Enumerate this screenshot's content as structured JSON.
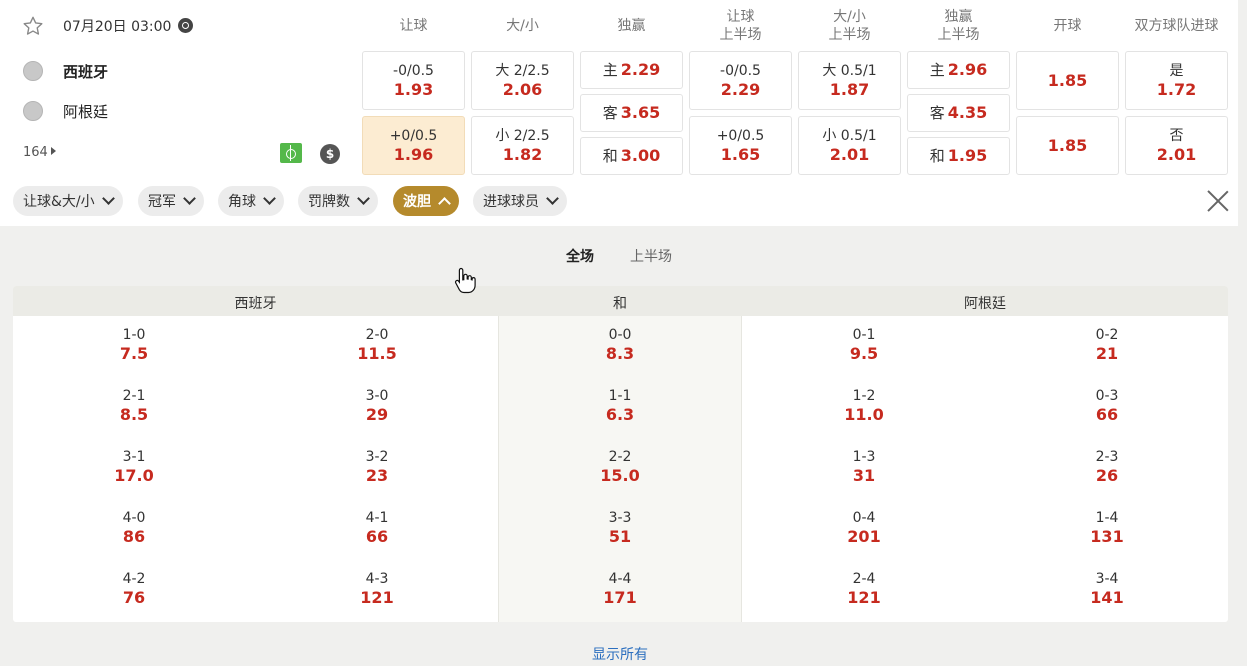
{
  "match": {
    "datetime": "07月20日 03:00",
    "home": "西班牙",
    "away": "阿根廷",
    "market_count": "164",
    "money_symbol": "$"
  },
  "headers": {
    "handicap": "让球",
    "total": "大/小",
    "moneyline": "独赢",
    "handicap_fh_1": "让球",
    "handicap_fh_2": "上半场",
    "total_fh_1": "大/小",
    "total_fh_2": "上半场",
    "moneyline_fh_1": "独赢",
    "moneyline_fh_2": "上半场",
    "kickoff": "开球",
    "btts": "双方球队进球"
  },
  "odds": {
    "handicap_home_line": "-0/0.5",
    "handicap_home": "1.93",
    "handicap_away_line": "+0/0.5",
    "handicap_away": "1.96",
    "total_over_line": "大 2/2.5",
    "total_over": "2.06",
    "total_under_line": "小 2/2.5",
    "total_under": "1.82",
    "ml_home_label": "主",
    "ml_home": "2.29",
    "ml_away_label": "客",
    "ml_away": "3.65",
    "ml_draw_label": "和",
    "ml_draw": "3.00",
    "fh_handicap_home_line": "-0/0.5",
    "fh_handicap_home": "2.29",
    "fh_handicap_away_line": "+0/0.5",
    "fh_handicap_away": "1.65",
    "fh_total_over_line": "大 0.5/1",
    "fh_total_over": "1.87",
    "fh_total_under_line": "小 0.5/1",
    "fh_total_under": "2.01",
    "fh_ml_home_label": "主",
    "fh_ml_home": "2.96",
    "fh_ml_away_label": "客",
    "fh_ml_away": "4.35",
    "fh_ml_draw_label": "和",
    "fh_ml_draw": "1.95",
    "kickoff_1": "1.85",
    "kickoff_2": "1.85",
    "btts_yes_label": "是",
    "btts_yes": "1.72",
    "btts_no_label": "否",
    "btts_no": "2.01"
  },
  "filters": [
    "让球&大/小",
    "冠军",
    "角球",
    "罚牌数",
    "波胆",
    "进球球员"
  ],
  "active_filter_index": 4,
  "tabs": [
    "全场",
    "上半场"
  ],
  "correct_score": {
    "headers": [
      "西班牙",
      "和",
      "阿根廷"
    ],
    "home": [
      {
        "score": "1-0",
        "odds": "7.5"
      },
      {
        "score": "2-0",
        "odds": "11.5"
      },
      {
        "score": "2-1",
        "odds": "8.5"
      },
      {
        "score": "3-0",
        "odds": "29"
      },
      {
        "score": "3-1",
        "odds": "17.0"
      },
      {
        "score": "3-2",
        "odds": "23"
      },
      {
        "score": "4-0",
        "odds": "86"
      },
      {
        "score": "4-1",
        "odds": "66"
      },
      {
        "score": "4-2",
        "odds": "76"
      },
      {
        "score": "4-3",
        "odds": "121"
      }
    ],
    "draw": [
      {
        "score": "0-0",
        "odds": "8.3"
      },
      {
        "score": "1-1",
        "odds": "6.3"
      },
      {
        "score": "2-2",
        "odds": "15.0"
      },
      {
        "score": "3-3",
        "odds": "51"
      },
      {
        "score": "4-4",
        "odds": "171"
      }
    ],
    "away": [
      {
        "score": "0-1",
        "odds": "9.5"
      },
      {
        "score": "0-2",
        "odds": "21"
      },
      {
        "score": "1-2",
        "odds": "11.0"
      },
      {
        "score": "0-3",
        "odds": "66"
      },
      {
        "score": "1-3",
        "odds": "31"
      },
      {
        "score": "2-3",
        "odds": "26"
      },
      {
        "score": "0-4",
        "odds": "201"
      },
      {
        "score": "1-4",
        "odds": "131"
      },
      {
        "score": "2-4",
        "odds": "121"
      },
      {
        "score": "3-4",
        "odds": "141"
      }
    ]
  },
  "show_all": "显示所有",
  "colors": {
    "odds_red": "#c62a1f",
    "active_pill": "#b58a2c",
    "highlight_box": "#fcecd2",
    "link_blue": "#2c6fbf"
  }
}
